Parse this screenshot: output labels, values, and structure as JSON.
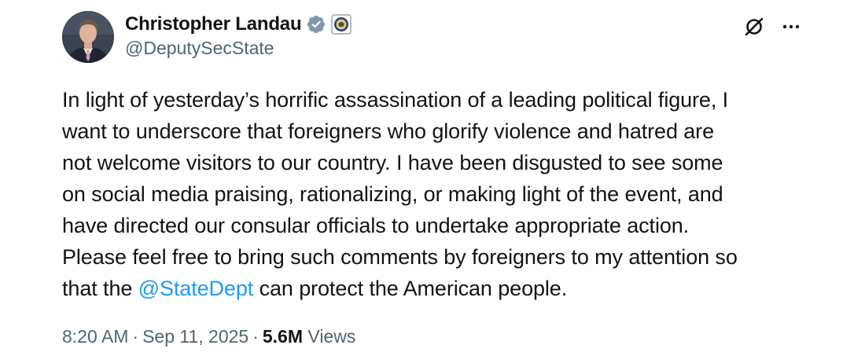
{
  "author": {
    "display_name": "Christopher Landau",
    "handle": "@DeputySecState",
    "badges": [
      "verified-badge-icon",
      "state-department-seal-icon"
    ]
  },
  "header_actions": {
    "grok_icon": "grok-icon",
    "more_icon": "more-options-icon"
  },
  "tweet": {
    "lines": [
      "In light of yesterday’s horrific assassination of a leading political figure, I",
      "want to underscore that foreigners who glorify violence and hatred are",
      "not welcome visitors to our country. I have been disgusted to see some",
      "on social media praising, rationalizing, or making light of the event, and",
      "have directed our consular officials to undertake appropriate action.",
      "Please feel free to bring such comments by foreigners to my attention so"
    ],
    "last_line_before": "that the ",
    "mention": "@StateDept",
    "last_line_after": " can protect the American people."
  },
  "meta": {
    "time": "8:20 AM",
    "separator": "·",
    "date": "Sep 11, 2025",
    "views_count": "5.6M",
    "views_label": "Views"
  },
  "colors": {
    "text": "#0f1419",
    "secondary": "#536471",
    "link": "#1d9bf0",
    "verified": "#829aab"
  }
}
